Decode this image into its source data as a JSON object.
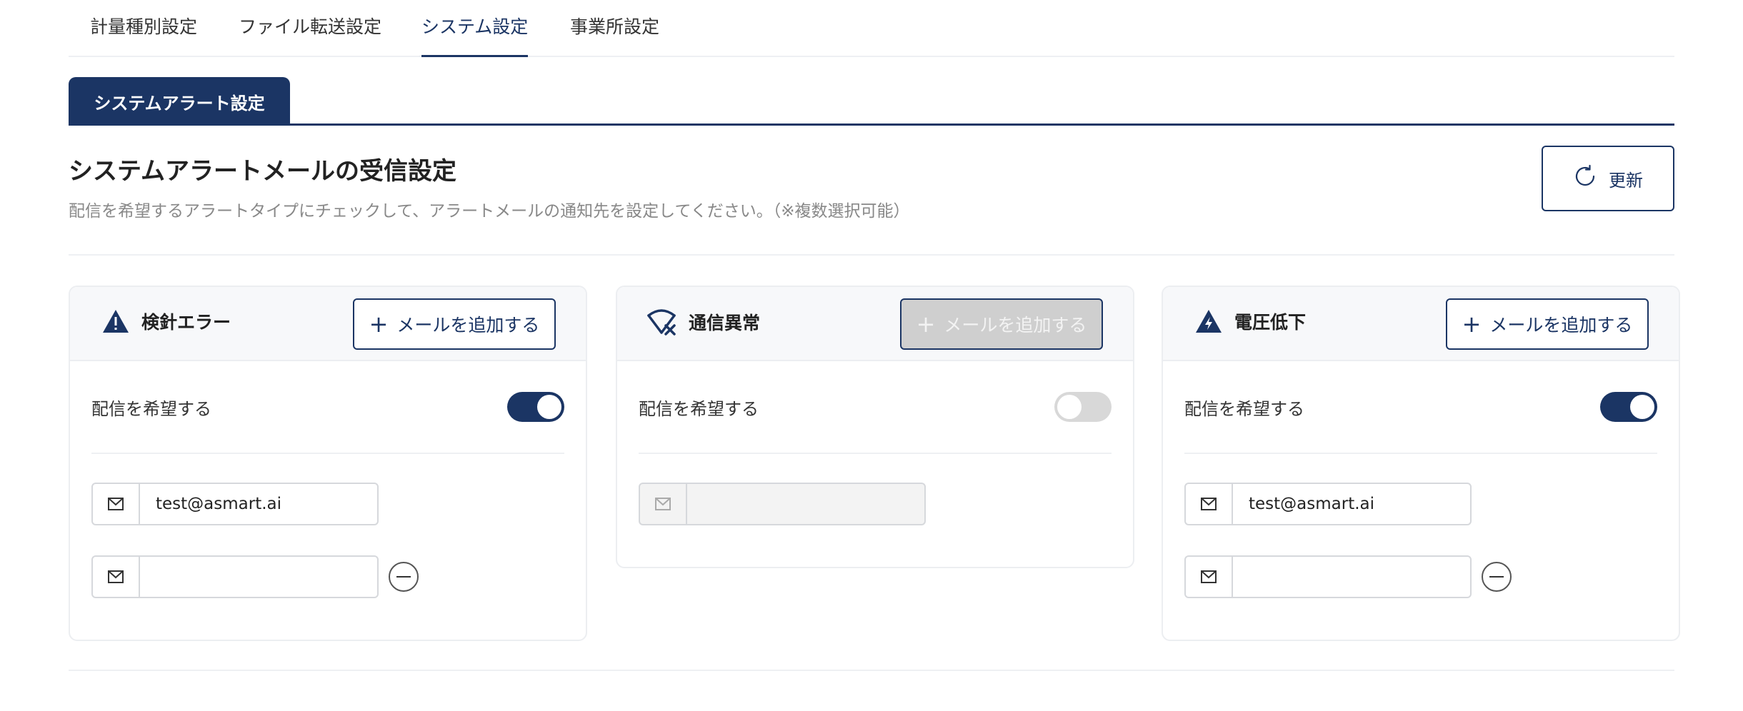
{
  "nav_tabs": [
    {
      "label": "計量種別設定",
      "active": false
    },
    {
      "label": "ファイル転送設定",
      "active": false
    },
    {
      "label": "システム設定",
      "active": true
    },
    {
      "label": "事業所設定",
      "active": false
    }
  ],
  "sub_tab": {
    "label": "システムアラート設定"
  },
  "header": {
    "title": "システムアラートメールの受信設定",
    "description": "配信を希望するアラートタイプにチェックして、アラートメールの通知先を設定してください。（※複数選択可能）",
    "refresh_label": "更新"
  },
  "colors": {
    "primary": "#1b3564",
    "toggle_off": "#d8d8d8",
    "disabled_button": "#cfcfcf"
  },
  "cards": [
    {
      "icon": "warning-triangle-icon",
      "title": "検針エラー",
      "add_label": "メールを追加する",
      "add_plus": "+",
      "add_disabled": false,
      "deliver_label": "配信を希望する",
      "deliver_enabled": true,
      "emails": [
        {
          "value": "test@asmart.ai"
        },
        {
          "value": ""
        }
      ]
    },
    {
      "icon": "wifi-off-icon",
      "title": "通信異常",
      "add_label": "メールを追加する",
      "add_plus": "+",
      "add_disabled": true,
      "deliver_label": "配信を希望する",
      "deliver_enabled": false,
      "emails": [
        {
          "value": ""
        }
      ]
    },
    {
      "icon": "voltage-triangle-icon",
      "title": "電圧低下",
      "add_label": "メールを追加する",
      "add_plus": "+",
      "add_disabled": false,
      "deliver_label": "配信を希望する",
      "deliver_enabled": true,
      "emails": [
        {
          "value": "test@asmart.ai"
        },
        {
          "value": ""
        }
      ]
    }
  ]
}
